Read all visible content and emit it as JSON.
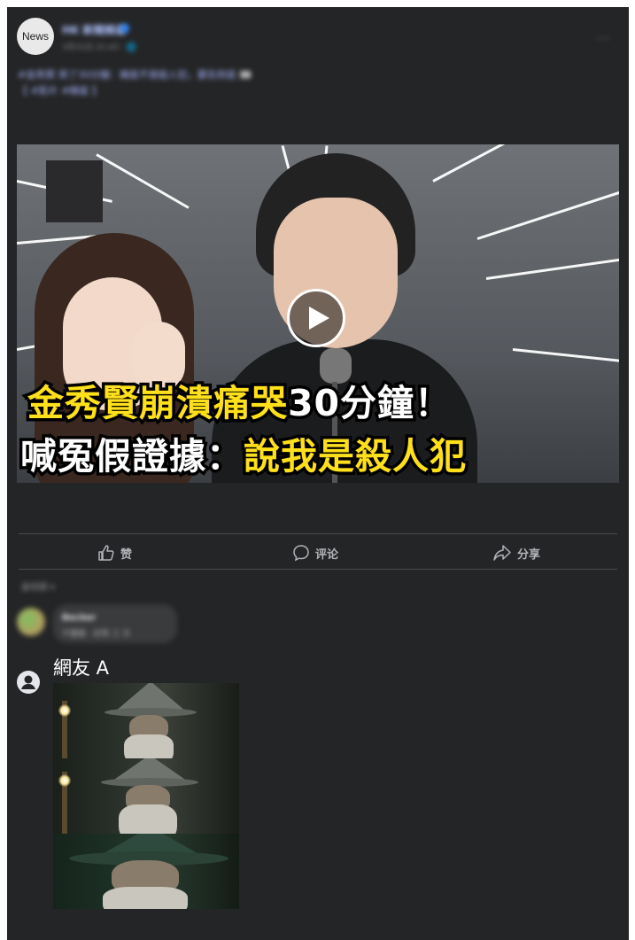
{
  "header": {
    "avatar_text": "News",
    "page_name": "HK 新聞頻道",
    "post_time": "3月31日 21:43 · 🌐",
    "more": "···"
  },
  "caption": {
    "line1": "#金秀賢 哭了30分鐘：稱我不是殺人犯，要告到底 👀",
    "line2": "【 #影片 #韓星 】"
  },
  "video": {
    "headline_1_yellow": "金秀賢崩潰痛哭",
    "headline_1_white": "30分鐘！",
    "headline_2_white": "喊冤假證據：",
    "headline_2_yellow": "說我是殺人犯"
  },
  "actions": {
    "like": "赞",
    "comment": "评论",
    "share": "分享"
  },
  "comments": {
    "sort_label": "最相關 ▾",
    "first_name": "Becker",
    "first_text": "不要臉 · 好笑 三 天",
    "second_name": "網友 A"
  },
  "colors": {
    "background": "#242526",
    "yellow_text": "#ffe01b",
    "accent_blue": "#2d88ff"
  }
}
